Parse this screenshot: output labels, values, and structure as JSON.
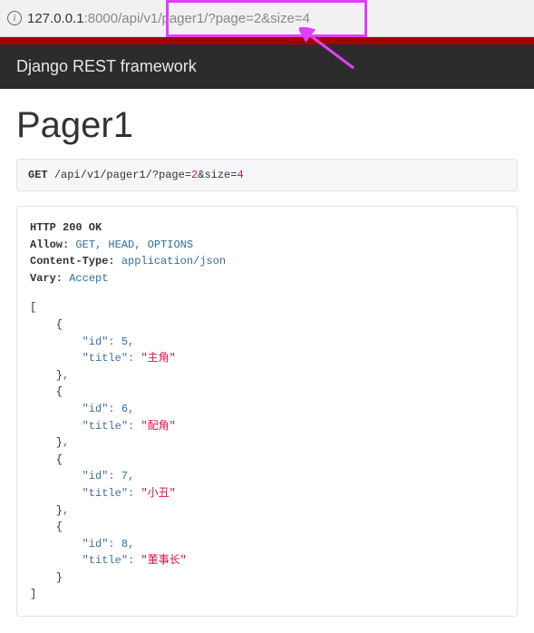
{
  "url": {
    "host": "127.0.0.1",
    "port": ":8000",
    "path_prefix": "/api/v1",
    "path_highlight": "/pager1/?page=",
    "page_val": "2",
    "size_param": "&size=",
    "size_val": "4"
  },
  "drf_header": "Django REST framework",
  "page_title": "Pager1",
  "request": {
    "method": "GET",
    "path": "/api/v1/pager1/?page=",
    "page": "2",
    "size_key": "&size=",
    "size": "4"
  },
  "response": {
    "status_line": "HTTP 200 OK",
    "headers": {
      "allow_key": "Allow:",
      "allow_val": "GET, HEAD, OPTIONS",
      "ct_key": "Content-Type:",
      "ct_val": "application/json",
      "vary_key": "Vary:",
      "vary_val": "Accept"
    },
    "body": [
      {
        "id": 5,
        "title": "主角"
      },
      {
        "id": 6,
        "title": "配角"
      },
      {
        "id": 7,
        "title": "小丑"
      },
      {
        "id": 8,
        "title": "董事长"
      }
    ]
  }
}
